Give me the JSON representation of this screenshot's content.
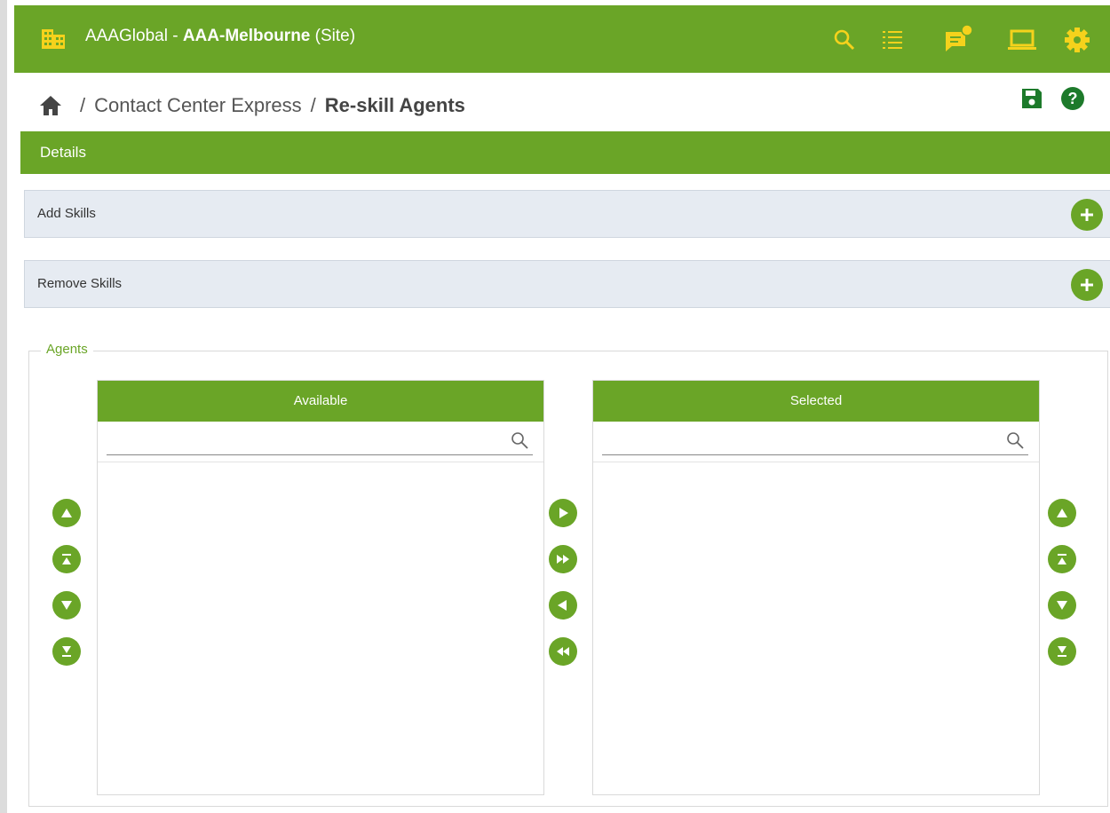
{
  "header": {
    "org": "AAAGlobal - ",
    "site_name": "AAA-Melbourne",
    "site_suffix": " (Site)",
    "accent": "#6aa527",
    "icons": [
      "search-icon",
      "list-icon",
      "chat-notification-icon",
      "laptop-icon",
      "gear-icon"
    ]
  },
  "breadcrumb": {
    "separator": "/",
    "parent": "Contact Center Express",
    "current": "Re-skill Agents"
  },
  "page_actions": [
    "save-icon",
    "help-icon"
  ],
  "details": {
    "label": "Details"
  },
  "add_skills": {
    "label": "Add Skills"
  },
  "remove_skills": {
    "label": "Remove Skills"
  },
  "agents": {
    "legend": "Agents",
    "available": {
      "header": "Available",
      "search_placeholder": "",
      "items": []
    },
    "selected": {
      "header": "Selected",
      "search_placeholder": "",
      "items": []
    }
  }
}
